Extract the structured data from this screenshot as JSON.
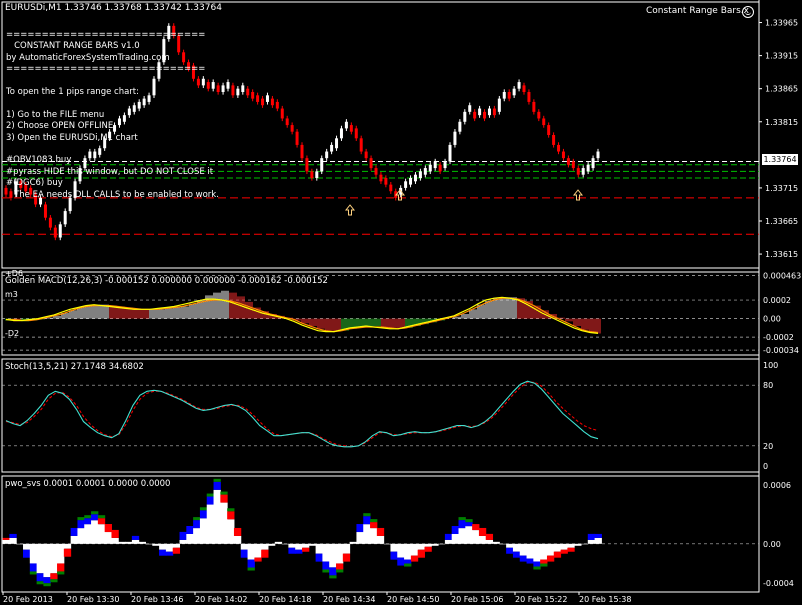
{
  "window": {
    "symbol_title": "EURUSDi,M1  1.33746 1.33768 1.33742 1.33764",
    "ea_name": "Constant Range Bars.x",
    "last_price": "1.33764"
  },
  "comment_lines": [
    "============================",
    "   CONSTANT RANGE BARS v1.0",
    "by AutomaticForexSystemTrading.com",
    "============================",
    "",
    "To open the 1 pips range chart:",
    "",
    "1) Go to the FILE menu",
    "2) Choose OPEN OFFLINE",
    "3) Open the EURUSDi,M1 chart",
    "",
    "#OBV1083 buy",
    "#pyrass HIDE this window, but DO NOT CLOSE it",
    "#(DGC6) buy",
    "   The EA needs DLL CALLS to be enabled to work."
  ],
  "panels": {
    "main": {
      "price_axis": [
        "1.33965",
        "1.33915",
        "1.33865",
        "1.33815",
        "1.33715",
        "1.33665",
        "1.33615"
      ],
      "left_labels": [
        "+D6"
      ]
    },
    "macd": {
      "title": "Golden MACD(12,26,3) -0.000152 0.000000 0.000000 -0.000162 -0.000152",
      "axis": [
        "0.000463",
        "0.0002",
        "0.00",
        "-0.0002",
        "-0.00034"
      ],
      "left_labels": [
        "m3",
        "-D2"
      ]
    },
    "stoch": {
      "title": "Stoch(13,5,21) 27.1748 34.6802",
      "axis": [
        "100",
        "80",
        "20",
        "0"
      ]
    },
    "pwo": {
      "title": "pwo_svs 0.0001 0.0001 0.0000 0.0000",
      "axis": [
        "0.0006",
        "0.00",
        "-0.0004"
      ]
    }
  },
  "time_axis": [
    "20 Feb 2013",
    "20 Feb 13:30",
    "20 Feb 13:46",
    "20 Feb 14:02",
    "20 Feb 14:18",
    "20 Feb 14:34",
    "20 Feb 14:50",
    "20 Feb 15:06",
    "20 Feb 15:22",
    "20 Feb 15:38"
  ],
  "colors": {
    "background": "#000000",
    "bull_candle": "#ffffff",
    "bear_candle": "#ff0000",
    "level_green": "#00c000",
    "level_red": "#ff0000",
    "level_white": "#ffffff",
    "macd_line": "#ffff00",
    "macd_signal": "#ff8c00",
    "hist_up": "#ffffff",
    "hist_down_a": "#ff3030",
    "hist_down_b": "#32cd32",
    "stoch_main": "#40e0d0",
    "stoch_signal": "#ff0000",
    "pwo_white": "#ffffff",
    "pwo_red": "#ff0000",
    "pwo_blue": "#0000ff",
    "pwo_green": "#008000"
  },
  "chart_data": [
    {
      "type": "candlestick",
      "title": "EURUSDi,M1",
      "ylim": [
        1.336,
        1.3399
      ],
      "closes": [
        1.3371,
        1.33705,
        1.33725,
        1.3372,
        1.33715,
        1.33705,
        1.3369,
        1.3369,
        1.3367,
        1.33655,
        1.3364,
        1.3366,
        1.3368,
        1.337,
        1.33725,
        1.33745,
        1.3376,
        1.3376,
        1.33765,
        1.33775,
        1.3379,
        1.338,
        1.3381,
        1.33815,
        1.33825,
        1.3383,
        1.33835,
        1.3384,
        1.33845,
        1.33855,
        1.3388,
        1.33905,
        1.3394,
        1.3396,
        1.33945,
        1.3392,
        1.33905,
        1.339,
        1.3388,
        1.3387,
        1.33875,
        1.33865,
        1.3387,
        1.3386,
        1.33865,
        1.3387,
        1.33855,
        1.3386,
        1.33865,
        1.3386,
        1.33855,
        1.3385,
        1.33845,
        1.3385,
        1.33845,
        1.33835,
        1.3382,
        1.3381,
        1.338,
        1.3378,
        1.3376,
        1.3374,
        1.3373,
        1.3374,
        1.3376,
        1.3377,
        1.33775,
        1.3379,
        1.33805,
        1.3381,
        1.33805,
        1.3379,
        1.3377,
        1.3376,
        1.33745,
        1.33735,
        1.3373,
        1.3372,
        1.3371,
        1.33705,
        1.33715,
        1.3372,
        1.33725,
        1.3373,
        1.33735,
        1.3374,
        1.33745,
        1.3375,
        1.33745,
        1.33755,
        1.3378,
        1.338,
        1.33815,
        1.3383,
        1.3383,
        1.33825,
        1.3383,
        1.33825,
        1.33835,
        1.3383,
        1.3385,
        1.3386,
        1.33855,
        1.33865,
        1.3387,
        1.3386,
        1.33845,
        1.3383,
        1.3382,
        1.3381,
        1.33795,
        1.3378,
        1.3377,
        1.3376,
        1.33755,
        1.33745,
        1.33735,
        1.3374,
        1.33745,
        1.3376,
        1.33764
      ]
    },
    {
      "type": "bar+line",
      "title": "Golden MACD(12,26,3)",
      "ylim": [
        -0.00036,
        0.00047
      ],
      "histogram": [
        -2e-05,
        -3e-05,
        -3e-05,
        -2e-05,
        -1e-05,
        1e-05,
        3e-05,
        6e-05,
        9e-05,
        0.00012,
        0.00014,
        0.00015,
        0.00015,
        0.00014,
        0.00013,
        0.00012,
        0.00011,
        0.0001,
        0.0001,
        0.0001,
        0.00011,
        0.00012,
        0.00013,
        0.00016,
        0.0002,
        0.00025,
        0.00028,
        0.0003,
        0.00028,
        0.00024,
        0.00018,
        0.00012,
        8e-05,
        5e-05,
        3e-05,
        1e-05,
        -2e-05,
        -5e-05,
        -8e-05,
        -0.00011,
        -0.00013,
        -0.00014,
        -0.00013,
        -0.00011,
        -9e-05,
        -8e-05,
        -8e-05,
        -9e-05,
        -0.0001,
        -0.00011,
        -0.0001,
        -8e-05,
        -6e-05,
        -4e-05,
        -2e-05,
        0.0,
        2e-05,
        5e-05,
        0.0001,
        0.00015,
        0.00019,
        0.00022,
        0.00023,
        0.00023,
        0.00022,
        0.00019,
        0.00014,
        9e-05,
        5e-05,
        1e-05,
        -3e-05,
        -8e-05,
        -0.00012,
        -0.00015,
        -0.00016
      ],
      "macd": [
        -1e-05,
        -2e-05,
        -2e-05,
        -1e-05,
        0.0,
        2e-05,
        4e-05,
        7e-05,
        0.0001,
        0.00012,
        0.00014,
        0.00015,
        0.00014,
        0.00013,
        0.00012,
        0.00011,
        0.0001,
        0.0001,
        0.0001,
        0.00011,
        0.00012,
        0.00013,
        0.00015,
        0.00017,
        0.00019,
        0.00021,
        0.00021,
        0.0002,
        0.00018,
        0.00015,
        0.00012,
        9e-05,
        6e-05,
        4e-05,
        2e-05,
        0.0,
        -3e-05,
        -7e-05,
        -0.0001,
        -0.00013,
        -0.00014,
        -0.00014,
        -0.00012,
        -0.0001,
        -9e-05,
        -8e-05,
        -9e-05,
        -0.0001,
        -0.00011,
        -0.00011,
        -9e-05,
        -7e-05,
        -5e-05,
        -3e-05,
        -1e-05,
        1e-05,
        3e-05,
        7e-05,
        0.00011,
        0.00016,
        0.0002,
        0.00022,
        0.00023,
        0.00022,
        0.0002,
        0.00016,
        0.00011,
        6e-05,
        2e-05,
        -2e-05,
        -6e-05,
        -0.0001,
        -0.00013,
        -0.00015,
        -0.00016
      ],
      "signal": [
        -1e-05,
        -1e-05,
        -2e-05,
        -2e-05,
        -1e-05,
        1e-05,
        3e-05,
        5e-05,
        8e-05,
        0.00011,
        0.00013,
        0.00014,
        0.00014,
        0.00014,
        0.00013,
        0.00012,
        0.00011,
        0.0001,
        0.0001,
        0.0001,
        0.00011,
        0.00012,
        0.00013,
        0.00015,
        0.00017,
        0.00019,
        0.0002,
        0.0002,
        0.00019,
        0.00017,
        0.00014,
        0.00011,
        8e-05,
        5e-05,
        3e-05,
        1e-05,
        -1e-05,
        -5e-05,
        -8e-05,
        -0.00011,
        -0.00013,
        -0.00014,
        -0.00013,
        -0.00011,
        -0.0001,
        -9e-05,
        -9e-05,
        -9e-05,
        -0.0001,
        -0.00011,
        -0.0001,
        -8e-05,
        -6e-05,
        -4e-05,
        -2e-05,
        0.0,
        2e-05,
        5e-05,
        9e-05,
        0.00013,
        0.00017,
        0.0002,
        0.00022,
        0.00022,
        0.00021,
        0.00018,
        0.00014,
        9e-05,
        4e-05,
        0.0,
        -4e-05,
        -8e-05,
        -0.00012,
        -0.00014,
        -0.00015
      ]
    },
    {
      "type": "line",
      "title": "Stoch(13,5,21)",
      "ylim": [
        0,
        100
      ],
      "levels": [
        80,
        20
      ],
      "series": [
        {
          "name": "main",
          "values": [
            45,
            42,
            40,
            45,
            52,
            60,
            70,
            74,
            72,
            66,
            56,
            44,
            38,
            33,
            30,
            28,
            32,
            45,
            60,
            70,
            74,
            75,
            74,
            71,
            68,
            65,
            61,
            57,
            55,
            56,
            58,
            60,
            61,
            59,
            55,
            48,
            40,
            35,
            30,
            30,
            31,
            32,
            33,
            33,
            30,
            26,
            22,
            20,
            19,
            19,
            20,
            24,
            30,
            34,
            33,
            30,
            31,
            33,
            34,
            33,
            33,
            34,
            36,
            38,
            40,
            40,
            38,
            40,
            44,
            50,
            58,
            66,
            74,
            81,
            84,
            82,
            76,
            68,
            60,
            52,
            46,
            40,
            34,
            29,
            27
          ]
        },
        {
          "name": "signal",
          "values": [
            44,
            43,
            41,
            43,
            49,
            56,
            66,
            72,
            73,
            68,
            60,
            49,
            41,
            35,
            31,
            29,
            31,
            41,
            55,
            66,
            72,
            74,
            74,
            72,
            69,
            66,
            62,
            58,
            56,
            56,
            57,
            59,
            60,
            60,
            57,
            51,
            44,
            37,
            32,
            30,
            31,
            32,
            33,
            33,
            31,
            27,
            24,
            21,
            20,
            19,
            20,
            23,
            28,
            33,
            33,
            31,
            31,
            32,
            33,
            33,
            33,
            34,
            35,
            37,
            39,
            40,
            39,
            40,
            43,
            48,
            55,
            63,
            71,
            78,
            83,
            83,
            79,
            72,
            64,
            57,
            51,
            45,
            40,
            37,
            35
          ]
        }
      ]
    },
    {
      "type": "stacked-histogram",
      "title": "pwo_svs",
      "ylim": [
        -0.00045,
        0.00065
      ],
      "values": [
        4e-05,
        6e-05,
        0.0,
        -6e-05,
        -0.0002,
        -0.0003,
        -0.00034,
        -0.0003,
        -0.0002,
        -5e-05,
        8e-05,
        0.00016,
        0.0002,
        0.00024,
        0.0002,
        0.00012,
        6e-05,
        2e-05,
        2e-05,
        4e-05,
        2e-05,
        0.0,
        -2e-05,
        -6e-05,
        -8e-05,
        -4e-05,
        4e-05,
        0.0001,
        0.00016,
        0.00026,
        0.0004,
        0.00055,
        0.00042,
        0.00025,
        8e-05,
        -6e-05,
        -0.00016,
        -0.00014,
        -6e-05,
        -2e-05,
        2e-05,
        0.0,
        -4e-05,
        -6e-05,
        -4e-05,
        -2e-05,
        -0.0001,
        -0.00018,
        -0.00024,
        -0.0002,
        -0.0001,
        2e-05,
        0.00012,
        0.0002,
        0.00016,
        8e-05,
        0.0,
        -8e-05,
        -0.00014,
        -0.00016,
        -0.00012,
        -6e-05,
        -3e-05,
        -2e-05,
        0.0,
        4e-05,
        0.0001,
        0.00016,
        0.00018,
        0.00014,
        8e-05,
        4e-05,
        2e-05,
        0.0,
        -4e-05,
        -8e-05,
        -0.00012,
        -0.00015,
        -0.00018,
        -0.00016,
        -0.00012,
        -8e-05,
        -6e-05,
        -4e-05,
        -2e-05,
        0.0,
        4e-05,
        6e-05
      ]
    }
  ]
}
